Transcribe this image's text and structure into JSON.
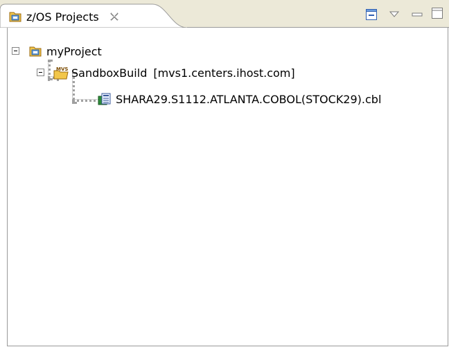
{
  "view": {
    "tab_title": "z/OS Projects",
    "close_icon": "close-icon",
    "toolbar": [
      "collapse-all-icon",
      "view-menu-icon",
      "minimize-icon",
      "maximize-icon"
    ]
  },
  "tree": {
    "project": {
      "label": "myProject",
      "icon": "project-icon",
      "expanded": true
    },
    "subproject": {
      "label": "SandboxBuild",
      "system": "[mvs1.centers.ihost.com]",
      "icon": "mvs-subproject-icon",
      "expanded": true
    },
    "file": {
      "label": "SHARA29.S1112.ATLANTA.COBOL(STOCK29).cbl",
      "icon": "cobol-file-icon"
    }
  }
}
